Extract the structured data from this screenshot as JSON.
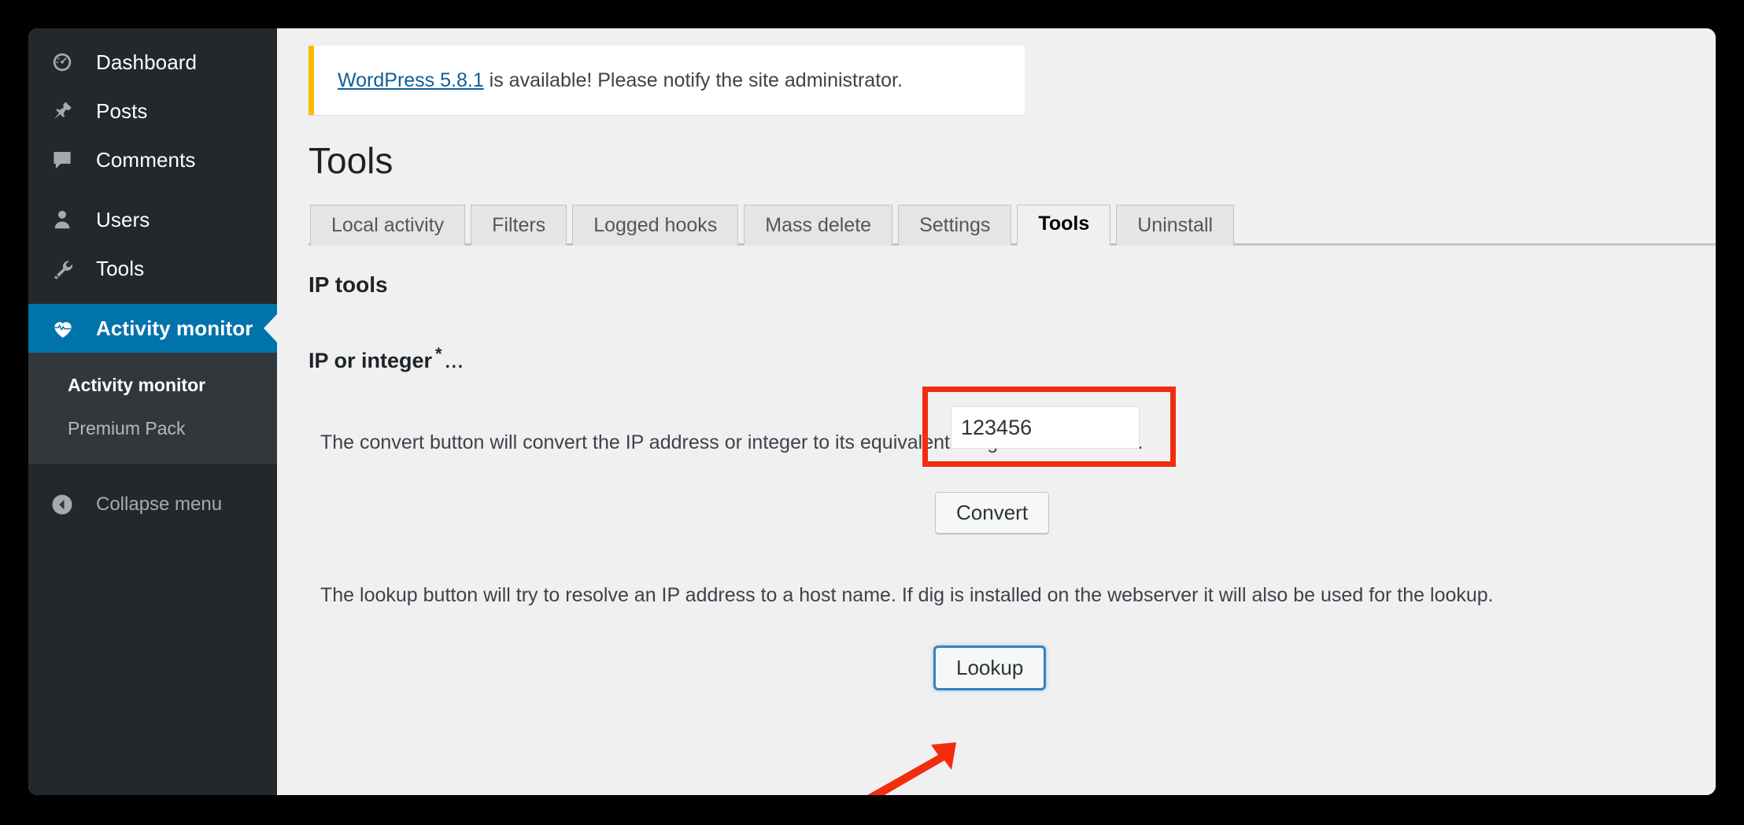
{
  "sidebar": {
    "items": [
      {
        "label": "Dashboard",
        "icon": "dashboard-icon",
        "current": false
      },
      {
        "label": "Posts",
        "icon": "pin-icon",
        "current": false
      },
      {
        "label": "Comments",
        "icon": "comment-icon",
        "current": false
      },
      {
        "label": "Users",
        "icon": "user-icon",
        "current": false
      },
      {
        "label": "Tools",
        "icon": "wrench-icon",
        "current": false
      },
      {
        "label": "Activity monitor",
        "icon": "heartbeat-icon",
        "current": true
      }
    ],
    "submenu": [
      {
        "label": "Activity monitor",
        "current": true
      },
      {
        "label": "Premium Pack",
        "current": false
      }
    ],
    "collapse_label": "Collapse menu",
    "collapse_icon": "chevron-left-circle-icon",
    "current_color": "#0073aa",
    "background_color": "#23282d",
    "submenu_background_color": "#32373c"
  },
  "notice": {
    "link_text": "WordPress 5.8.1",
    "rest_text": " is available! Please notify the site administrator.",
    "accent_color": "#ffb900",
    "link_color": "#135e96"
  },
  "page": {
    "title": "Tools"
  },
  "tabs": [
    {
      "label": "Local activity",
      "active": false
    },
    {
      "label": "Filters",
      "active": false
    },
    {
      "label": "Logged hooks",
      "active": false
    },
    {
      "label": "Mass delete",
      "active": false
    },
    {
      "label": "Settings",
      "active": false
    },
    {
      "label": "Tools",
      "active": true
    },
    {
      "label": "Uninstall",
      "active": false
    }
  ],
  "main": {
    "section_title": "IP tools",
    "field": {
      "label": "IP or integer",
      "required_marker": "*",
      "hint_marker": "...",
      "value": "123456",
      "placeholder": ""
    },
    "convert_help": "The convert button will convert the IP address or integer to its equivalent integer or IP address.",
    "convert_button": "Convert",
    "lookup_help": "The lookup button will try to resolve an IP address to a host name. If dig is installed on the webserver it will also be used for the lookup.",
    "lookup_button": "Lookup"
  },
  "annotations": {
    "highlight_color": "#f22c0d",
    "arrow_color": "#f22c0d",
    "highlight_target": "IP or integer input",
    "arrow_target": "Lookup button"
  }
}
